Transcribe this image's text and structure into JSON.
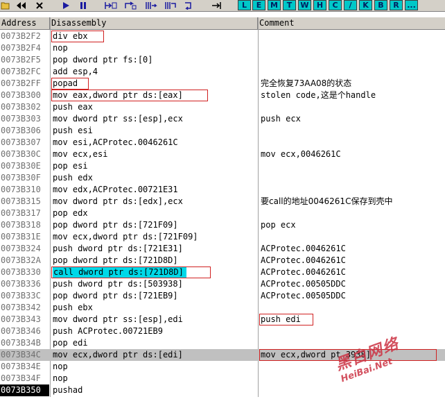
{
  "toolbar": {
    "buttons": [
      "open-icon",
      "rewind-icon",
      "close-icon",
      "play-icon",
      "pause-icon",
      "step-into-icon",
      "step-over-icon",
      "trace-into-icon",
      "trace-over-icon",
      "execute-till-return-icon",
      "goto-icon"
    ],
    "letters": [
      "L",
      "E",
      "M",
      "T",
      "W",
      "H",
      "C",
      "/",
      "K",
      "B",
      "R",
      "..."
    ]
  },
  "headers": {
    "address": "Address",
    "disassembly": "Disassembly",
    "comment": "Comment"
  },
  "rows": [
    {
      "addr": "0073B2F2",
      "dis": "div ebx",
      "com": ""
    },
    {
      "addr": "0073B2F4",
      "dis": "nop",
      "com": ""
    },
    {
      "addr": "0073B2F5",
      "dis": "pop dword ptr fs:[0]",
      "com": ""
    },
    {
      "addr": "0073B2FC",
      "dis": "add esp,4",
      "com": ""
    },
    {
      "addr": "0073B2FF",
      "dis": "popad",
      "com": "完全恢复73AA08的状态"
    },
    {
      "addr": "0073B300",
      "dis": "mov eax,dword ptr ds:[eax]",
      "com": "stolen code,这是个handle"
    },
    {
      "addr": "0073B302",
      "dis": "push eax",
      "com": ""
    },
    {
      "addr": "0073B303",
      "dis": "mov dword ptr ss:[esp],ecx",
      "com": "push ecx"
    },
    {
      "addr": "0073B306",
      "dis": "push esi",
      "com": ""
    },
    {
      "addr": "0073B307",
      "dis": "mov esi,ACProtec.0046261C",
      "com": ""
    },
    {
      "addr": "0073B30C",
      "dis": "mov ecx,esi",
      "com": "mov ecx,0046261C"
    },
    {
      "addr": "0073B30E",
      "dis": "pop esi",
      "com": ""
    },
    {
      "addr": "0073B30F",
      "dis": "push edx",
      "com": ""
    },
    {
      "addr": "0073B310",
      "dis": "mov edx,ACProtec.00721E31",
      "com": ""
    },
    {
      "addr": "0073B315",
      "dis": "mov dword ptr ds:[edx],ecx",
      "com": "要call的地址0046261C保存到壳中"
    },
    {
      "addr": "0073B317",
      "dis": "pop edx",
      "com": ""
    },
    {
      "addr": "0073B318",
      "dis": "pop dword ptr ds:[721F09]",
      "com": "pop ecx"
    },
    {
      "addr": "0073B31E",
      "dis": "mov ecx,dword ptr ds:[721F09]",
      "com": ""
    },
    {
      "addr": "0073B324",
      "dis": "push dword ptr ds:[721E31]",
      "com": "ACProtec.0046261C"
    },
    {
      "addr": "0073B32A",
      "dis": "pop dword ptr ds:[721D8D]",
      "com": "ACProtec.0046261C"
    },
    {
      "addr": "0073B330",
      "dis": "call dword ptr ds:[721D8D]",
      "com": "ACProtec.0046261C"
    },
    {
      "addr": "0073B336",
      "dis": "push dword ptr ds:[503938]",
      "com": "ACProtec.00505DDC"
    },
    {
      "addr": "0073B33C",
      "dis": "pop dword ptr ds:[721EB9]",
      "com": "ACProtec.00505DDC"
    },
    {
      "addr": "0073B342",
      "dis": "push ebx",
      "com": ""
    },
    {
      "addr": "0073B343",
      "dis": "mov dword ptr ss:[esp],edi",
      "com": "push edi"
    },
    {
      "addr": "0073B346",
      "dis": "push ACProtec.00721EB9",
      "com": ""
    },
    {
      "addr": "0073B34B",
      "dis": "pop edi",
      "com": ""
    },
    {
      "addr": "0073B34C",
      "dis": "mov ecx,dword ptr ds:[edi]",
      "com": "mov ecx,dword pt    3938]"
    },
    {
      "addr": "0073B34E",
      "dis": "nop",
      "com": ""
    },
    {
      "addr": "0073B34F",
      "dis": "nop",
      "com": ""
    },
    {
      "addr": "0073B350",
      "dis": "pushad",
      "com": ""
    }
  ],
  "watermark": {
    "big": "黑白网络",
    "small": "HeiBai.Net"
  },
  "colors": {
    "toolbar": "#d4d0c8",
    "letterButton": "#00c8c8",
    "highlight": "#00d8e8",
    "annotation": "#d02020"
  }
}
